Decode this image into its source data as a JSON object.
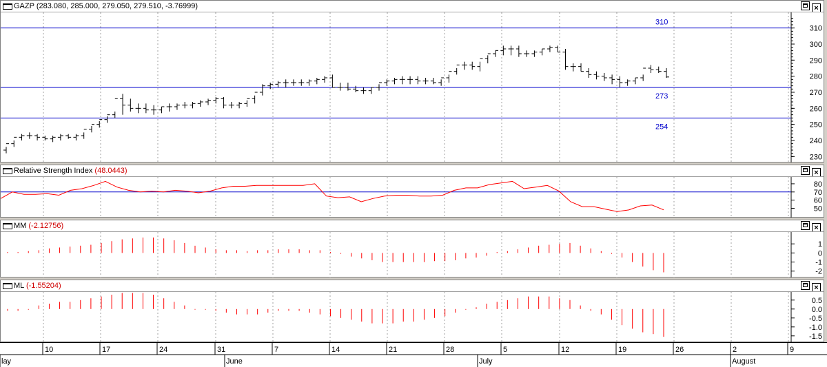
{
  "price_panel": {
    "title": "GAZP",
    "ohlc_text": "(283.080, 285.000, 279.050, 279.510, -3.76999)",
    "hlines": [
      {
        "value": 310,
        "label": "310"
      },
      {
        "value": 273,
        "label": "273"
      },
      {
        "value": 254,
        "label": "254"
      }
    ],
    "yticks": [
      230,
      240,
      250,
      260,
      270,
      280,
      290,
      300,
      310
    ],
    "ylim": [
      228,
      318
    ]
  },
  "rsi_panel": {
    "title": "Relative Strength Index",
    "value_text": "(48.0443)",
    "hline": 70,
    "yticks": [
      50,
      60,
      70,
      80
    ],
    "ylim": [
      42,
      85
    ]
  },
  "mm_panel": {
    "title": "MM",
    "value_text": "(-2.12756)",
    "yticks": [
      -2,
      -1,
      0,
      1
    ],
    "ylim": [
      -2.4,
      2.0
    ]
  },
  "ml_panel": {
    "title": "ML",
    "value_text": "(-1.55204)",
    "yticks": [
      -1.5,
      -1.0,
      -0.5,
      0.0,
      0.5
    ],
    "ytick_labels": [
      "-1.5",
      "-1.0",
      "-0.5",
      "0.0",
      "0.5"
    ],
    "ylim": [
      -1.7,
      0.8
    ]
  },
  "window_buttons": {
    "max": "",
    "close": "×"
  },
  "date_axis": {
    "day_labels": [
      "10",
      "17",
      "24",
      "31",
      "7",
      "14",
      "21",
      "28",
      "5",
      "12",
      "19",
      "26",
      "2",
      "9"
    ],
    "month_labels": [
      "lay",
      "June",
      "July",
      "August"
    ]
  },
  "colors": {
    "hline": "#0000cc",
    "rsi": "#ff0000",
    "bars": "#000000",
    "hist": "#ff0000"
  },
  "chart_data": {
    "type": "ohlc",
    "title": "GAZP",
    "price": {
      "open": [
        234,
        238,
        242,
        243,
        243,
        242,
        241,
        242,
        243,
        242,
        243,
        247,
        250,
        253,
        256,
        266,
        262,
        260,
        260,
        259,
        259,
        261,
        261,
        262,
        262,
        263,
        264,
        265,
        266,
        262,
        262,
        263,
        266,
        270,
        274,
        275,
        276,
        276,
        276,
        276,
        277,
        278,
        279,
        273,
        273,
        272,
        271,
        271,
        273,
        276,
        277,
        278,
        278,
        278,
        277,
        277,
        276,
        279,
        283,
        287,
        287,
        286,
        291,
        294,
        296,
        297,
        297,
        294,
        294,
        295,
        297,
        298,
        295,
        286,
        286,
        283,
        281,
        280,
        279,
        278,
        276,
        277,
        279,
        285,
        284,
        283
      ],
      "high": [
        236,
        240,
        244,
        245,
        244,
        243,
        243,
        244,
        244,
        244,
        245,
        249,
        252,
        255,
        258,
        269,
        266,
        263,
        263,
        262,
        261,
        263,
        263,
        264,
        264,
        265,
        266,
        267,
        267,
        264,
        264,
        265,
        268,
        275,
        276,
        277,
        278,
        278,
        278,
        278,
        279,
        280,
        281,
        276,
        276,
        274,
        273,
        273,
        275,
        278,
        279,
        280,
        280,
        280,
        279,
        279,
        278,
        281,
        285,
        289,
        289,
        289,
        293,
        296,
        299,
        299,
        299,
        296,
        296,
        297,
        299,
        299,
        297,
        288,
        288,
        285,
        283,
        282,
        281,
        280,
        278,
        279,
        281,
        287,
        286,
        285
      ],
      "low": [
        232,
        236,
        240,
        241,
        240,
        240,
        239,
        240,
        241,
        240,
        241,
        245,
        248,
        251,
        254,
        256,
        258,
        257,
        257,
        256,
        257,
        258,
        259,
        260,
        260,
        261,
        262,
        263,
        260,
        260,
        260,
        261,
        263,
        268,
        272,
        273,
        273,
        274,
        274,
        274,
        275,
        276,
        273,
        271,
        271,
        270,
        269,
        269,
        271,
        274,
        275,
        275,
        275,
        275,
        275,
        275,
        274,
        276,
        281,
        284,
        284,
        283,
        288,
        292,
        293,
        293,
        292,
        292,
        292,
        293,
        295,
        295,
        284,
        283,
        283,
        279,
        278,
        277,
        275,
        273,
        274,
        275,
        277,
        282,
        282,
        279
      ],
      "close": [
        238,
        242,
        243,
        243,
        242,
        241,
        242,
        243,
        242,
        243,
        247,
        250,
        253,
        256,
        266,
        262,
        260,
        260,
        259,
        259,
        261,
        261,
        262,
        262,
        263,
        264,
        265,
        266,
        262,
        262,
        263,
        266,
        270,
        274,
        275,
        276,
        276,
        276,
        276,
        277,
        278,
        279,
        273,
        273,
        272,
        271,
        271,
        273,
        276,
        277,
        278,
        278,
        278,
        277,
        277,
        276,
        279,
        283,
        287,
        287,
        286,
        291,
        294,
        296,
        297,
        297,
        294,
        294,
        295,
        297,
        298,
        295,
        286,
        286,
        283,
        281,
        280,
        279,
        278,
        276,
        277,
        279,
        285,
        284,
        283,
        279.51
      ]
    },
    "rsi": [
      62,
      70,
      67,
      67,
      68,
      66,
      72,
      74,
      78,
      83,
      76,
      72,
      70,
      71,
      70,
      72,
      71,
      69,
      71,
      75,
      77,
      77,
      78,
      78,
      78,
      78,
      78,
      80,
      65,
      63,
      64,
      58,
      62,
      65,
      66,
      66,
      65,
      65,
      66,
      72,
      75,
      75,
      79,
      81,
      83,
      74,
      76,
      78,
      71,
      58,
      52,
      52,
      49,
      46,
      48,
      53,
      54,
      48.04
    ],
    "mm": [
      0.1,
      0.1,
      0.2,
      0.3,
      0.5,
      0.6,
      0.7,
      0.8,
      0.9,
      1.1,
      1.3,
      1.5,
      1.6,
      1.7,
      1.7,
      1.6,
      1.4,
      1.1,
      0.8,
      0.6,
      0.4,
      0.3,
      0.3,
      0.2,
      0.3,
      0.3,
      0.4,
      0.4,
      0.4,
      0.3,
      0.3,
      0.1,
      -0.1,
      -0.4,
      -0.6,
      -0.8,
      -1.0,
      -1.0,
      -1.0,
      -1.0,
      -1.0,
      -0.9,
      -0.9,
      -0.8,
      -0.6,
      -0.5,
      -0.3,
      0.1,
      0.2,
      0.4,
      0.6,
      0.8,
      0.9,
      1.0,
      1.1,
      0.8,
      0.5,
      0.2,
      -0.1,
      -0.5,
      -1.0,
      -1.5,
      -1.9,
      -2.13
    ],
    "ml": [
      -0.1,
      -0.1,
      0.0,
      0.2,
      0.3,
      0.4,
      0.4,
      0.5,
      0.6,
      0.7,
      0.8,
      0.9,
      0.9,
      0.9,
      0.8,
      0.6,
      0.4,
      0.2,
      0.0,
      0.0,
      -0.1,
      -0.2,
      -0.3,
      -0.3,
      -0.3,
      -0.2,
      -0.1,
      -0.1,
      -0.1,
      -0.2,
      -0.3,
      -0.4,
      -0.5,
      -0.6,
      -0.7,
      -0.8,
      -0.8,
      -0.8,
      -0.7,
      -0.7,
      -0.6,
      -0.5,
      -0.4,
      -0.2,
      0.0,
      0.1,
      0.3,
      0.4,
      0.5,
      0.6,
      0.7,
      0.7,
      0.7,
      0.6,
      0.5,
      0.2,
      -0.1,
      -0.3,
      -0.6,
      -0.9,
      -1.1,
      -1.3,
      -1.4,
      -1.55
    ]
  }
}
